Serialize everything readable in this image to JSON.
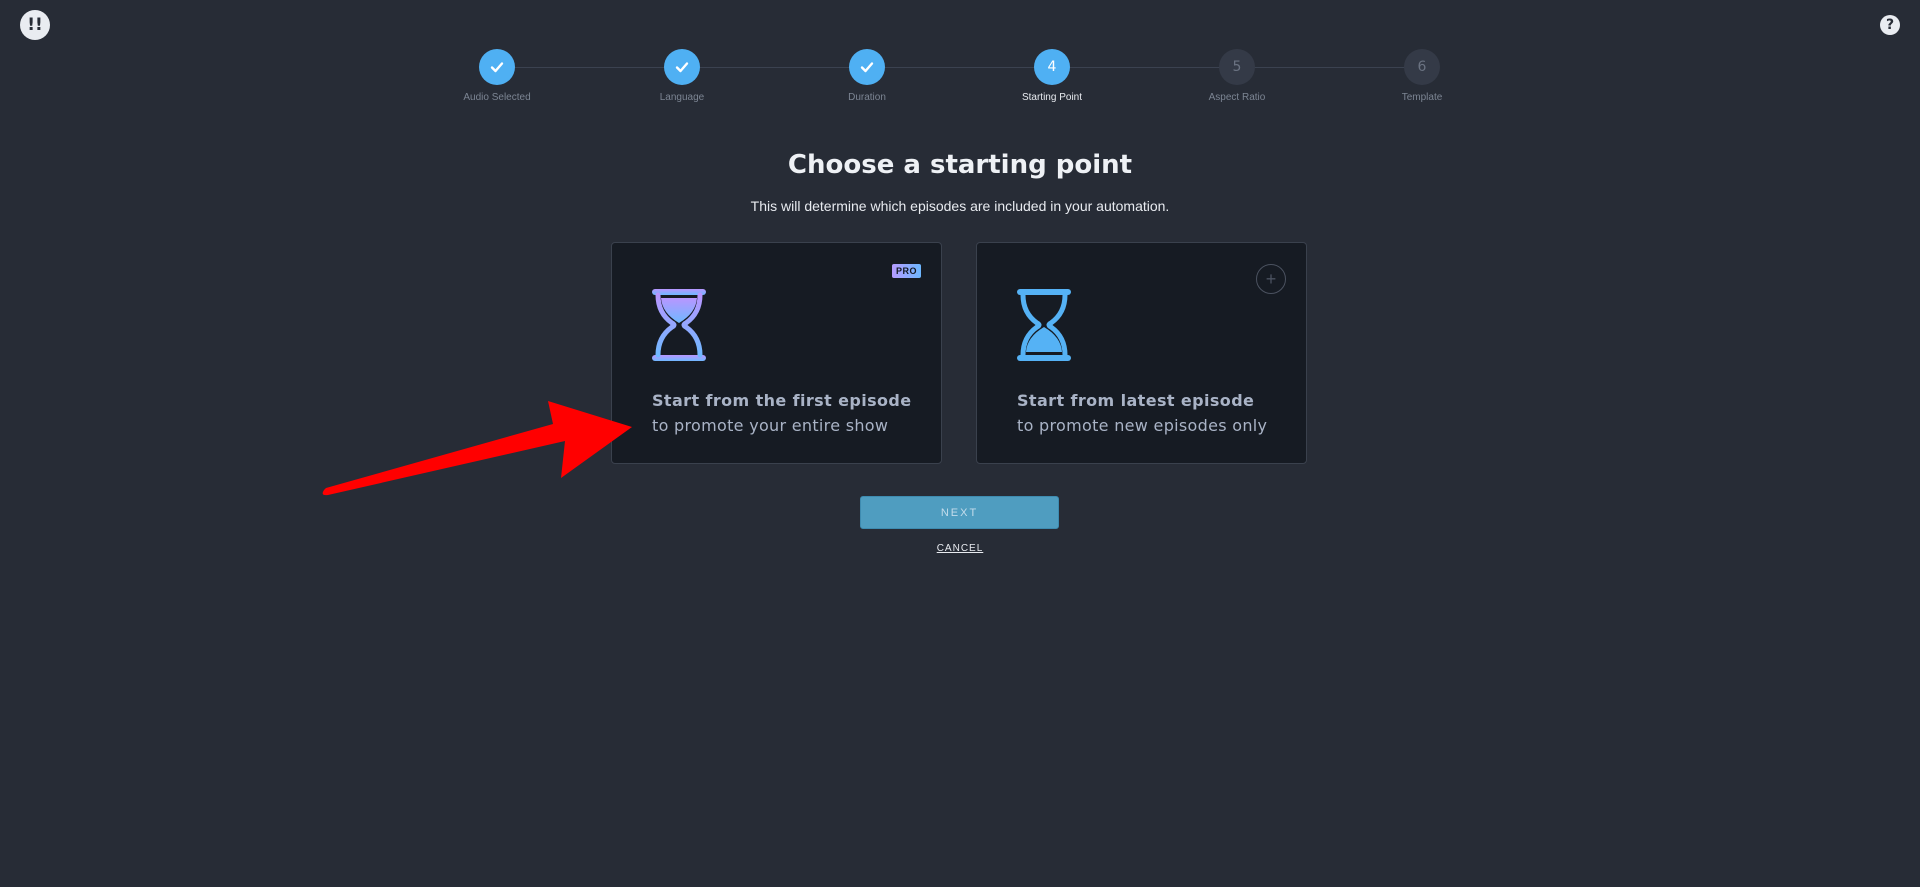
{
  "header": {
    "logo_text": "!!",
    "help_icon": "?"
  },
  "stepper": {
    "steps": [
      {
        "number": "1",
        "label": "Audio Selected",
        "status": "done"
      },
      {
        "number": "2",
        "label": "Language",
        "status": "done"
      },
      {
        "number": "3",
        "label": "Duration",
        "status": "done"
      },
      {
        "number": "4",
        "label": "Starting Point",
        "status": "active"
      },
      {
        "number": "5",
        "label": "Aspect Ratio",
        "status": "todo"
      },
      {
        "number": "6",
        "label": "Template",
        "status": "todo"
      }
    ]
  },
  "main": {
    "title": "Choose a starting point",
    "subtitle": "This will determine which episodes are included in your automation."
  },
  "options": {
    "first": {
      "badge": "PRO",
      "title": "Start from the first episode",
      "description": "to promote your entire show",
      "icon": "hourglass-gradient-icon"
    },
    "latest": {
      "title": "Start from latest episode",
      "description": "to promote new episodes only",
      "icon": "hourglass-solid-icon",
      "add_icon": "+"
    }
  },
  "actions": {
    "next_label": "NEXT",
    "cancel_label": "CANCEL"
  },
  "colors": {
    "background": "#272c36",
    "accent": "#4fb0f3",
    "card": "#161b23",
    "annotation_arrow": "#ff0000"
  }
}
